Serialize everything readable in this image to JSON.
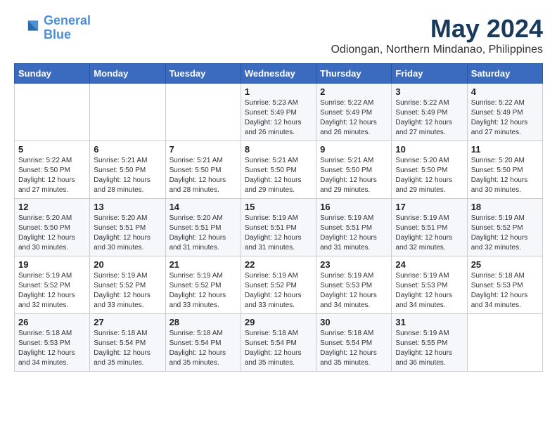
{
  "logo": {
    "line1": "General",
    "line2": "Blue"
  },
  "title": "May 2024",
  "subtitle": "Odiongan, Northern Mindanao, Philippines",
  "headers": [
    "Sunday",
    "Monday",
    "Tuesday",
    "Wednesday",
    "Thursday",
    "Friday",
    "Saturday"
  ],
  "weeks": [
    [
      {
        "day": "",
        "info": ""
      },
      {
        "day": "",
        "info": ""
      },
      {
        "day": "",
        "info": ""
      },
      {
        "day": "1",
        "info": "Sunrise: 5:23 AM\nSunset: 5:49 PM\nDaylight: 12 hours\nand 26 minutes."
      },
      {
        "day": "2",
        "info": "Sunrise: 5:22 AM\nSunset: 5:49 PM\nDaylight: 12 hours\nand 26 minutes."
      },
      {
        "day": "3",
        "info": "Sunrise: 5:22 AM\nSunset: 5:49 PM\nDaylight: 12 hours\nand 27 minutes."
      },
      {
        "day": "4",
        "info": "Sunrise: 5:22 AM\nSunset: 5:49 PM\nDaylight: 12 hours\nand 27 minutes."
      }
    ],
    [
      {
        "day": "5",
        "info": "Sunrise: 5:22 AM\nSunset: 5:50 PM\nDaylight: 12 hours\nand 27 minutes."
      },
      {
        "day": "6",
        "info": "Sunrise: 5:21 AM\nSunset: 5:50 PM\nDaylight: 12 hours\nand 28 minutes."
      },
      {
        "day": "7",
        "info": "Sunrise: 5:21 AM\nSunset: 5:50 PM\nDaylight: 12 hours\nand 28 minutes."
      },
      {
        "day": "8",
        "info": "Sunrise: 5:21 AM\nSunset: 5:50 PM\nDaylight: 12 hours\nand 29 minutes."
      },
      {
        "day": "9",
        "info": "Sunrise: 5:21 AM\nSunset: 5:50 PM\nDaylight: 12 hours\nand 29 minutes."
      },
      {
        "day": "10",
        "info": "Sunrise: 5:20 AM\nSunset: 5:50 PM\nDaylight: 12 hours\nand 29 minutes."
      },
      {
        "day": "11",
        "info": "Sunrise: 5:20 AM\nSunset: 5:50 PM\nDaylight: 12 hours\nand 30 minutes."
      }
    ],
    [
      {
        "day": "12",
        "info": "Sunrise: 5:20 AM\nSunset: 5:50 PM\nDaylight: 12 hours\nand 30 minutes."
      },
      {
        "day": "13",
        "info": "Sunrise: 5:20 AM\nSunset: 5:51 PM\nDaylight: 12 hours\nand 30 minutes."
      },
      {
        "day": "14",
        "info": "Sunrise: 5:20 AM\nSunset: 5:51 PM\nDaylight: 12 hours\nand 31 minutes."
      },
      {
        "day": "15",
        "info": "Sunrise: 5:19 AM\nSunset: 5:51 PM\nDaylight: 12 hours\nand 31 minutes."
      },
      {
        "day": "16",
        "info": "Sunrise: 5:19 AM\nSunset: 5:51 PM\nDaylight: 12 hours\nand 31 minutes."
      },
      {
        "day": "17",
        "info": "Sunrise: 5:19 AM\nSunset: 5:51 PM\nDaylight: 12 hours\nand 32 minutes."
      },
      {
        "day": "18",
        "info": "Sunrise: 5:19 AM\nSunset: 5:52 PM\nDaylight: 12 hours\nand 32 minutes."
      }
    ],
    [
      {
        "day": "19",
        "info": "Sunrise: 5:19 AM\nSunset: 5:52 PM\nDaylight: 12 hours\nand 32 minutes."
      },
      {
        "day": "20",
        "info": "Sunrise: 5:19 AM\nSunset: 5:52 PM\nDaylight: 12 hours\nand 33 minutes."
      },
      {
        "day": "21",
        "info": "Sunrise: 5:19 AM\nSunset: 5:52 PM\nDaylight: 12 hours\nand 33 minutes."
      },
      {
        "day": "22",
        "info": "Sunrise: 5:19 AM\nSunset: 5:52 PM\nDaylight: 12 hours\nand 33 minutes."
      },
      {
        "day": "23",
        "info": "Sunrise: 5:19 AM\nSunset: 5:53 PM\nDaylight: 12 hours\nand 34 minutes."
      },
      {
        "day": "24",
        "info": "Sunrise: 5:19 AM\nSunset: 5:53 PM\nDaylight: 12 hours\nand 34 minutes."
      },
      {
        "day": "25",
        "info": "Sunrise: 5:18 AM\nSunset: 5:53 PM\nDaylight: 12 hours\nand 34 minutes."
      }
    ],
    [
      {
        "day": "26",
        "info": "Sunrise: 5:18 AM\nSunset: 5:53 PM\nDaylight: 12 hours\nand 34 minutes."
      },
      {
        "day": "27",
        "info": "Sunrise: 5:18 AM\nSunset: 5:54 PM\nDaylight: 12 hours\nand 35 minutes."
      },
      {
        "day": "28",
        "info": "Sunrise: 5:18 AM\nSunset: 5:54 PM\nDaylight: 12 hours\nand 35 minutes."
      },
      {
        "day": "29",
        "info": "Sunrise: 5:18 AM\nSunset: 5:54 PM\nDaylight: 12 hours\nand 35 minutes."
      },
      {
        "day": "30",
        "info": "Sunrise: 5:18 AM\nSunset: 5:54 PM\nDaylight: 12 hours\nand 35 minutes."
      },
      {
        "day": "31",
        "info": "Sunrise: 5:19 AM\nSunset: 5:55 PM\nDaylight: 12 hours\nand 36 minutes."
      },
      {
        "day": "",
        "info": ""
      }
    ]
  ]
}
